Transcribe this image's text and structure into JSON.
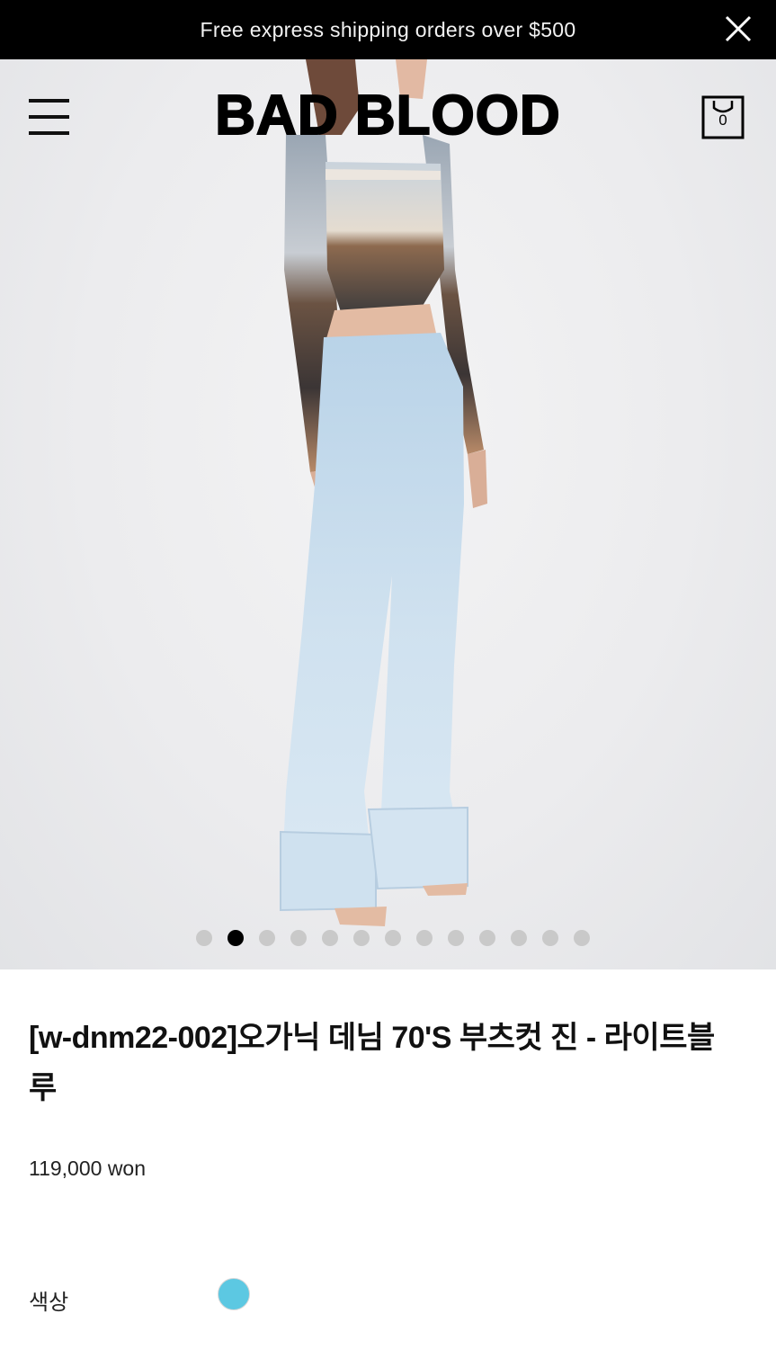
{
  "promo": {
    "text": "Free express shipping orders over $500"
  },
  "header": {
    "logo": "BAD BLOOD",
    "cart_count": "0"
  },
  "gallery": {
    "dot_count": 13,
    "active_index": 1
  },
  "product": {
    "title": "[w-dnm22-002]오가닉 데님 70'S 부츠컷 진 - 라이트블루",
    "price": "119,000 won",
    "color_label": "색상",
    "swatch_color": "#5cc8e2"
  },
  "colors": {
    "promo_bg": "#000000",
    "accent_dot": "#000000",
    "inactive_dot": "#c9c9c9"
  }
}
